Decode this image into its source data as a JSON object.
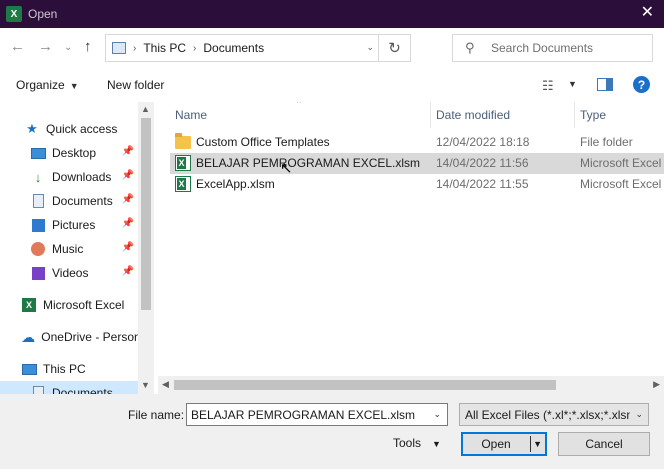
{
  "window": {
    "title": "Open",
    "app_icon_letter": "X"
  },
  "nav_buttons": {
    "back": "←",
    "forward": "→",
    "recent": "⌄",
    "up": "↑"
  },
  "address": {
    "crumbs": [
      "This PC",
      "Documents"
    ],
    "search_placeholder": "Search Documents"
  },
  "toolbar": {
    "organize_label": "Organize",
    "new_folder_label": "New folder"
  },
  "sidebar": {
    "items": [
      {
        "label": "Quick access",
        "icon": "star-icon",
        "pinned": false
      },
      {
        "label": "Desktop",
        "icon": "desktop-icon",
        "pinned": true
      },
      {
        "label": "Downloads",
        "icon": "download-icon",
        "pinned": true
      },
      {
        "label": "Documents",
        "icon": "documents-icon",
        "pinned": true
      },
      {
        "label": "Pictures",
        "icon": "pictures-icon",
        "pinned": true
      },
      {
        "label": "Music",
        "icon": "music-icon",
        "pinned": true
      },
      {
        "label": "Videos",
        "icon": "videos-icon",
        "pinned": true
      },
      {
        "label": "Microsoft Excel",
        "icon": "excel-icon",
        "pinned": false
      },
      {
        "label": "OneDrive - Persor",
        "icon": "cloud-icon",
        "pinned": false
      },
      {
        "label": "This PC",
        "icon": "pc-icon",
        "pinned": false
      },
      {
        "label": "Documents",
        "icon": "documents-icon",
        "pinned": false
      }
    ]
  },
  "columns": {
    "name": "Name",
    "date": "Date modified",
    "type": "Type"
  },
  "files": [
    {
      "name": "Custom Office Templates",
      "date": "12/04/2022 18:18",
      "type": "File folder",
      "icon": "folder-icon"
    },
    {
      "name": "BELAJAR PEMROGRAMAN EXCEL.xlsm",
      "date": "14/04/2022 11:56",
      "type": "Microsoft Excel",
      "icon": "excel-file-icon"
    },
    {
      "name": "ExcelApp.xlsm",
      "date": "14/04/2022 11:55",
      "type": "Microsoft Excel",
      "icon": "excel-file-icon"
    }
  ],
  "bottom": {
    "file_name_label": "File name:",
    "file_name_value": "BELAJAR PEMROGRAMAN EXCEL.xlsm",
    "filter_value": "All Excel Files (*.xl*;*.xlsx;*.xlsm",
    "tools_label": "Tools",
    "open_label": "Open",
    "cancel_label": "Cancel"
  },
  "colors": {
    "titlebar": "#2b0f3a",
    "excel_green": "#1d7a45",
    "accent_blue": "#0078d7",
    "selected_nav": "#cde8ff",
    "hover_row": "#d9d9d9"
  }
}
